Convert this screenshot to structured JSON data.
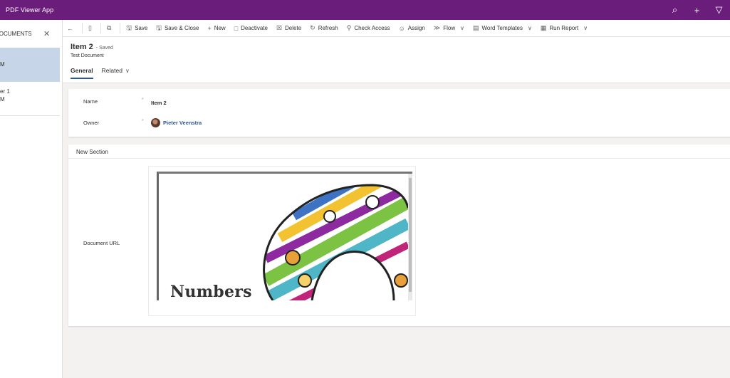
{
  "app": {
    "title": "PDF Viewer App"
  },
  "top_icons": [
    "search-icon",
    "plus-icon",
    "filter-icon"
  ],
  "left_panel": {
    "title": "DOCUMENTS",
    "items": [
      {
        "line1": "",
        "line2": "M",
        "selected": true
      },
      {
        "line1": "er 1",
        "line2": "M",
        "selected": false
      }
    ]
  },
  "command_bar": {
    "items": [
      {
        "label": "Save",
        "icon": "save-icon"
      },
      {
        "label": "Save & Close",
        "icon": "save-close-icon"
      },
      {
        "label": "New",
        "icon": "plus-icon"
      },
      {
        "label": "Deactivate",
        "icon": "deactivate-icon"
      },
      {
        "label": "Delete",
        "icon": "delete-icon"
      },
      {
        "label": "Refresh",
        "icon": "refresh-icon"
      },
      {
        "label": "Check Access",
        "icon": "check-access-icon"
      },
      {
        "label": "Assign",
        "icon": "assign-icon"
      },
      {
        "label": "Flow",
        "icon": "flow-icon"
      },
      {
        "label": "Word Templates",
        "icon": "word-templates-icon"
      },
      {
        "label": "Run Report",
        "icon": "run-report-icon"
      }
    ]
  },
  "record": {
    "title": "Item 2",
    "status": "- Saved",
    "entity": "Test Document",
    "tabs": [
      "General",
      "Related"
    ]
  },
  "form": {
    "name_label": "Name",
    "name_value": "Item 2",
    "owner_label": "Owner",
    "owner_value": "Pieter Veenstra",
    "required_marker": "*",
    "section_title": "New Section",
    "document_url_label": "Document URL"
  },
  "pdf": {
    "visible_text": "Numbers"
  }
}
